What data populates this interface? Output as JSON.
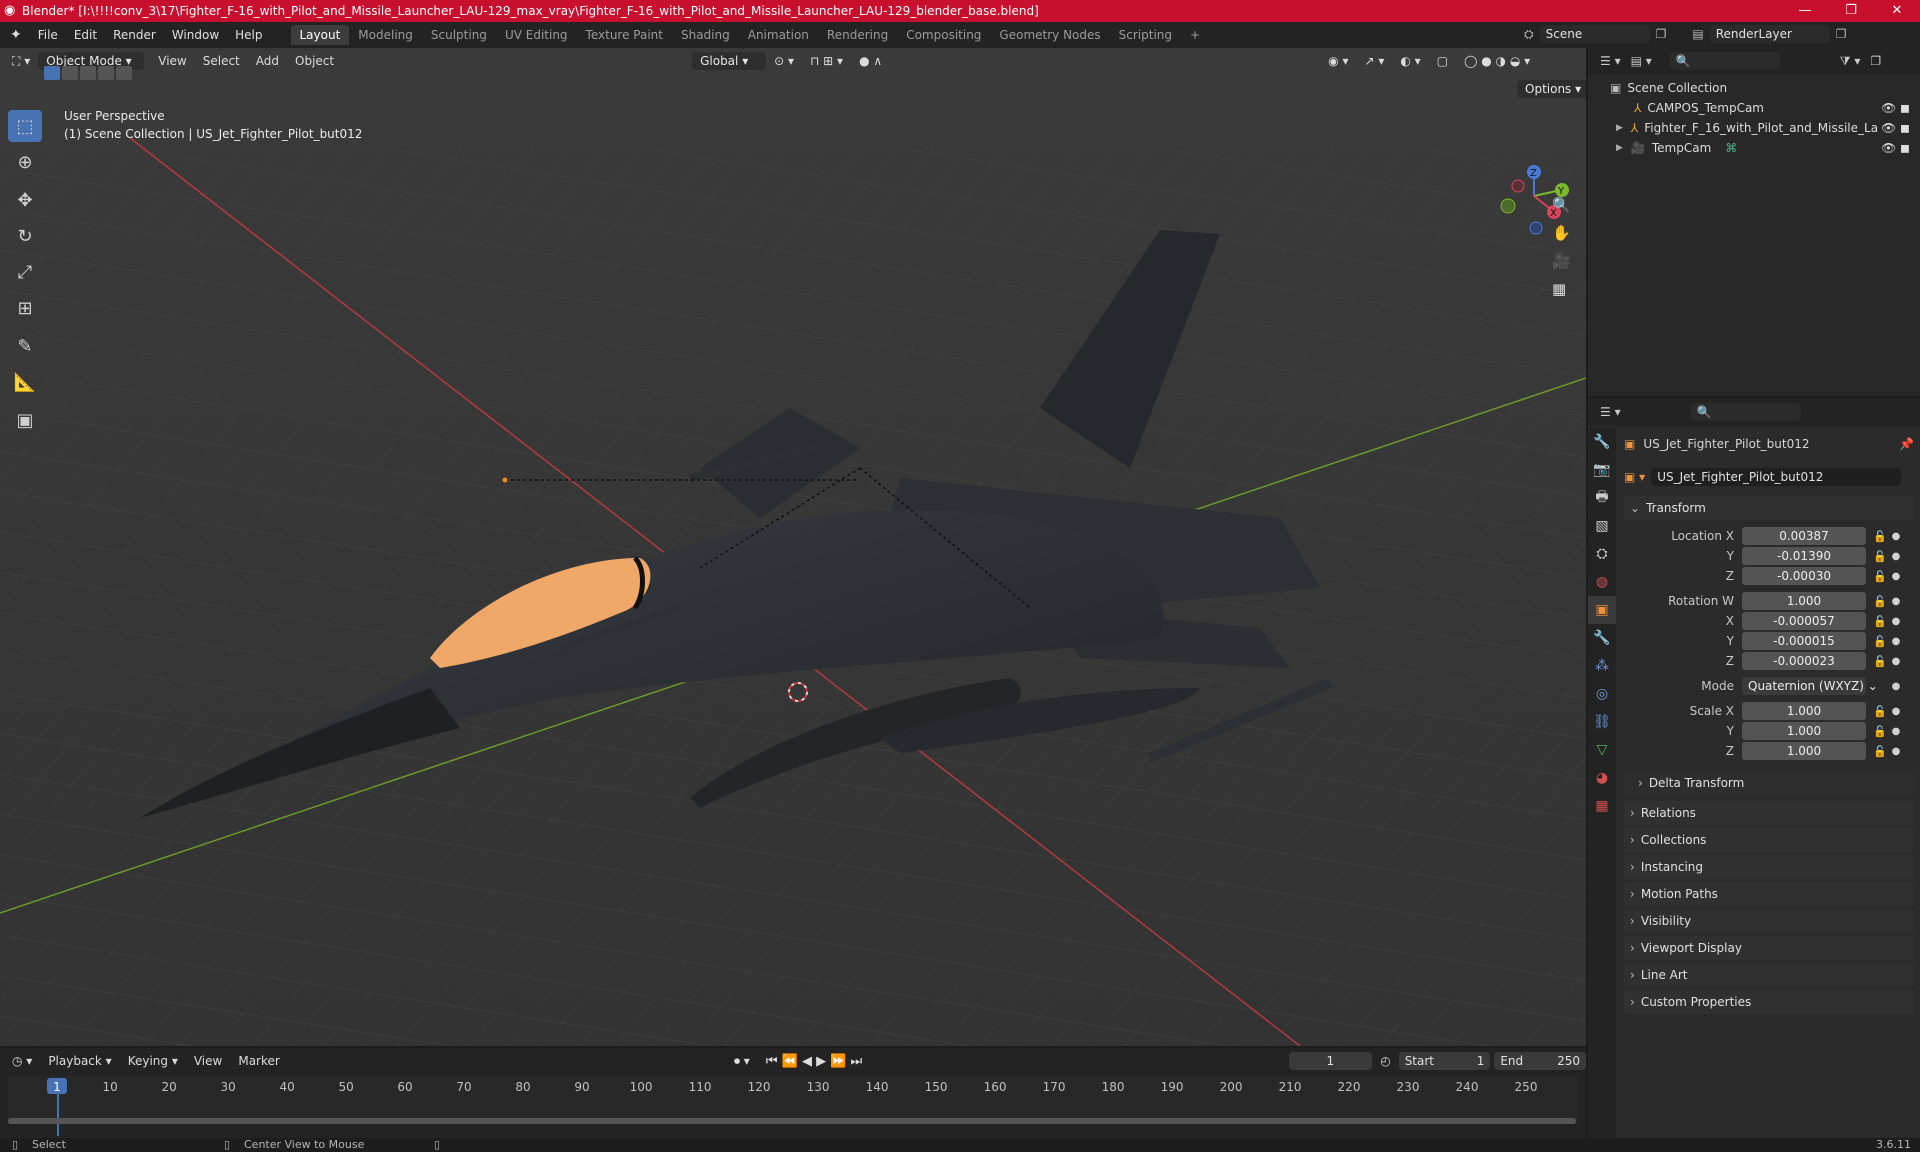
{
  "window": {
    "title": "Blender* [I:\\!!!!conv_3\\17\\Fighter_F-16_with_Pilot_and_Missile_Launcher_LAU-129_max_vray\\Fighter_F-16_with_Pilot_and_Missile_Launcher_LAU-129_blender_base.blend]",
    "minimize": "—",
    "maximize": "❐",
    "close": "✕"
  },
  "menu": [
    "File",
    "Edit",
    "Render",
    "Window",
    "Help"
  ],
  "workspaces": [
    "Layout",
    "Modeling",
    "Sculpting",
    "UV Editing",
    "Texture Paint",
    "Shading",
    "Animation",
    "Rendering",
    "Compositing",
    "Geometry Nodes",
    "Scripting"
  ],
  "workspace_add": "+",
  "scene": {
    "name": "Scene",
    "render_layer": "RenderLayer"
  },
  "viewport": {
    "mode": "Object Mode",
    "menus": [
      "View",
      "Select",
      "Add",
      "Object"
    ],
    "transform_orientation": "Global",
    "options_label": "Options",
    "perspective_label": "User Perspective",
    "collection_label": "(1) Scene Collection | US_Jet_Fighter_Pilot_but012",
    "gizmo": {
      "z": "Z",
      "y": "Y",
      "x": "X"
    },
    "colors": {
      "background": "#393939",
      "grid": "#454545",
      "x_axis": "#b33a3a",
      "y_axis": "#6a9a2a",
      "canopy": "#f0a868",
      "jet": "#2a2d31"
    }
  },
  "outliner": {
    "root": "Scene Collection",
    "items": [
      {
        "name": "CAMPOS_TempCam"
      },
      {
        "name": "Fighter_F_16_with_Pilot_and_Missile_La"
      },
      {
        "name": "TempCam"
      }
    ]
  },
  "properties": {
    "object_name": "US_Jet_Fighter_Pilot_but012",
    "data_name": "US_Jet_Fighter_Pilot_but012",
    "transform_label": "Transform",
    "location": {
      "label": "Location X",
      "x": "0.00387",
      "y": "-0.01390",
      "z": "-0.00030"
    },
    "rotation": {
      "label": "Rotation W",
      "w": "1.000",
      "x": "-0.000057",
      "y": "-0.000015",
      "z": "-0.000023"
    },
    "mode": {
      "label": "Mode",
      "value": "Quaternion (WXYZ)"
    },
    "scale": {
      "label": "Scale X",
      "x": "1.000",
      "y": "1.000",
      "z": "1.000"
    },
    "axis_labels": {
      "y": "Y",
      "z": "Z",
      "x": "X"
    },
    "delta_transform": "Delta Transform",
    "panels": [
      "Relations",
      "Collections",
      "Instancing",
      "Motion Paths",
      "Visibility",
      "Viewport Display",
      "Line Art",
      "Custom Properties"
    ]
  },
  "timeline": {
    "menus": [
      "Playback",
      "Keying",
      "View",
      "Marker"
    ],
    "current_frame": "1",
    "start_label": "Start",
    "start": "1",
    "end_label": "End",
    "end": "250",
    "ticks": [
      "1",
      "10",
      "20",
      "30",
      "40",
      "50",
      "60",
      "70",
      "80",
      "90",
      "100",
      "110",
      "120",
      "130",
      "140",
      "150",
      "160",
      "170",
      "180",
      "190",
      "200",
      "210",
      "220",
      "230",
      "240",
      "250"
    ]
  },
  "statusbar": {
    "select": "Select",
    "center": "Center View to Mouse",
    "version": "3.6.11"
  }
}
